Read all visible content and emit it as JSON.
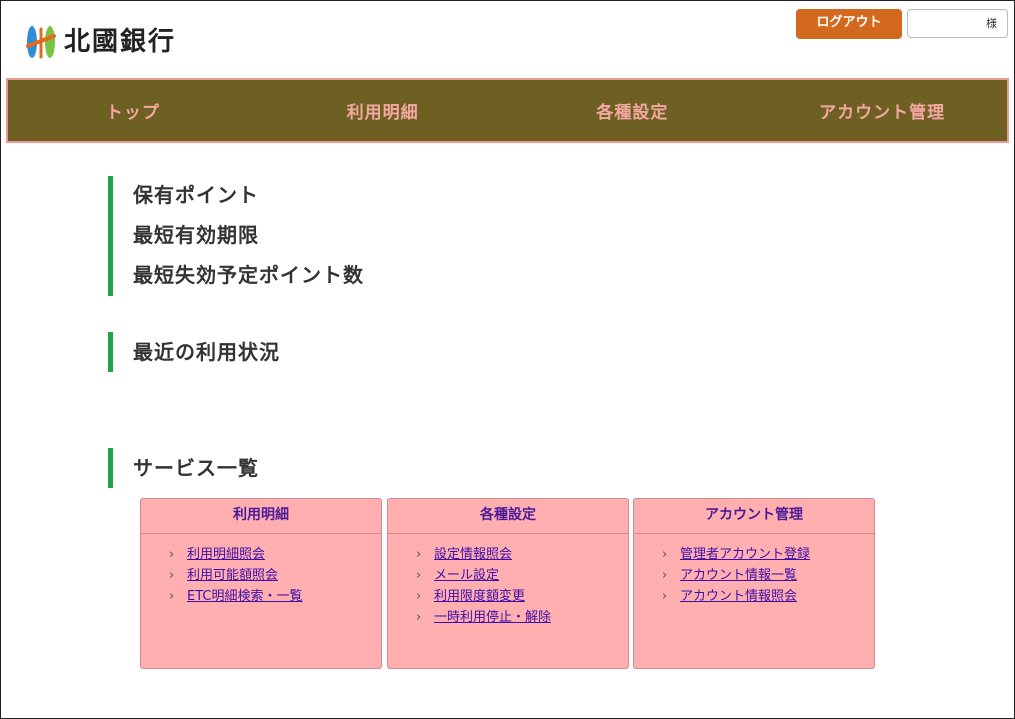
{
  "header": {
    "bank_name": "北國銀行",
    "logout_label": "ログアウト",
    "user_suffix": "様"
  },
  "nav": {
    "items": [
      {
        "label": "トップ"
      },
      {
        "label": "利用明細"
      },
      {
        "label": "各種設定"
      },
      {
        "label": "アカウント管理"
      }
    ]
  },
  "points": {
    "lines": [
      "保有ポイント",
      "最短有効期限",
      "最短失効予定ポイント数"
    ]
  },
  "recent": {
    "title": "最近の利用状況"
  },
  "services": {
    "title": "サービス一覧",
    "boxes": [
      {
        "title": "利用明細",
        "links": [
          "利用明細照会",
          "利用可能額照会",
          "ETC明細検索・一覧"
        ]
      },
      {
        "title": "各種設定",
        "links": [
          "設定情報照会",
          "メール設定",
          "利用限度額変更",
          "一時利用停止・解除"
        ]
      },
      {
        "title": "アカウント管理",
        "links": [
          "管理者アカウント登録",
          "アカウント情報一覧",
          "アカウント情報照会"
        ]
      }
    ]
  },
  "colors": {
    "nav_bg": "#6e5f22",
    "nav_text": "#f3a8a2",
    "logout_bg": "#d2691e",
    "section_bar": "#21a44a",
    "service_box_bg": "#ffafb0",
    "link": "#3e0fa8"
  },
  "icons": {
    "logo": "hokkoku-logo-icon",
    "link_bullet": "chevron-right-icon"
  }
}
